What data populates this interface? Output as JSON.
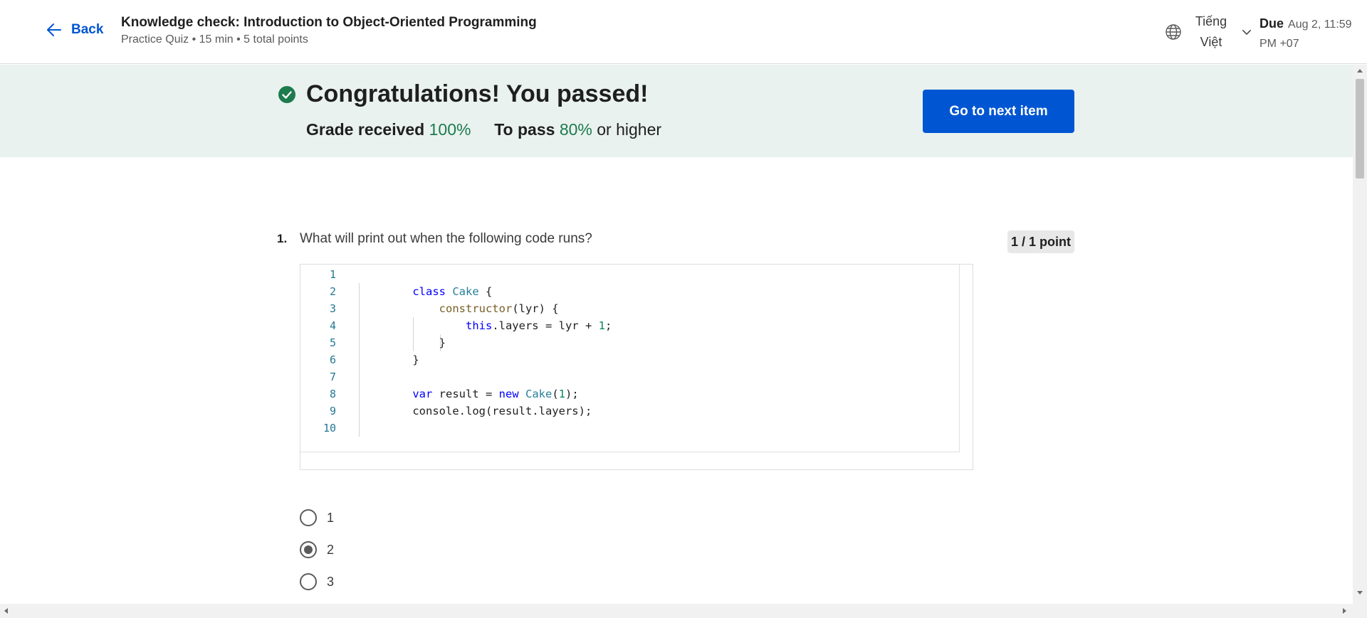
{
  "header": {
    "back_label": "Back",
    "title": "Knowledge check: Introduction to Object-Oriented Programming",
    "meta": "Practice Quiz • 15 min • 5 total points",
    "language_line1": "Tiếng",
    "language_line2": "Việt",
    "due_label": "Due",
    "due_value": "Aug 2, 11:59 PM +07"
  },
  "banner": {
    "heading": "Congratulations! You passed!",
    "grade_label": "Grade received",
    "grade_value": "100%",
    "pass_label": "To pass",
    "pass_value": "80%",
    "pass_suffix": "or higher",
    "next_button": "Go to next item"
  },
  "question": {
    "number": "1.",
    "text": "What will print out when the following code runs?",
    "points": "1 / 1 point",
    "line_numbers": [
      "1",
      "2",
      "3",
      "4",
      "5",
      "6",
      "7",
      "8",
      "9",
      "10"
    ],
    "options": [
      {
        "label": "1",
        "selected": false
      },
      {
        "label": "2",
        "selected": true
      },
      {
        "label": "3",
        "selected": false
      }
    ]
  },
  "colors": {
    "accent": "#0056d2",
    "banner_bg": "#e9f2ef",
    "success": "#1e7b4e"
  }
}
